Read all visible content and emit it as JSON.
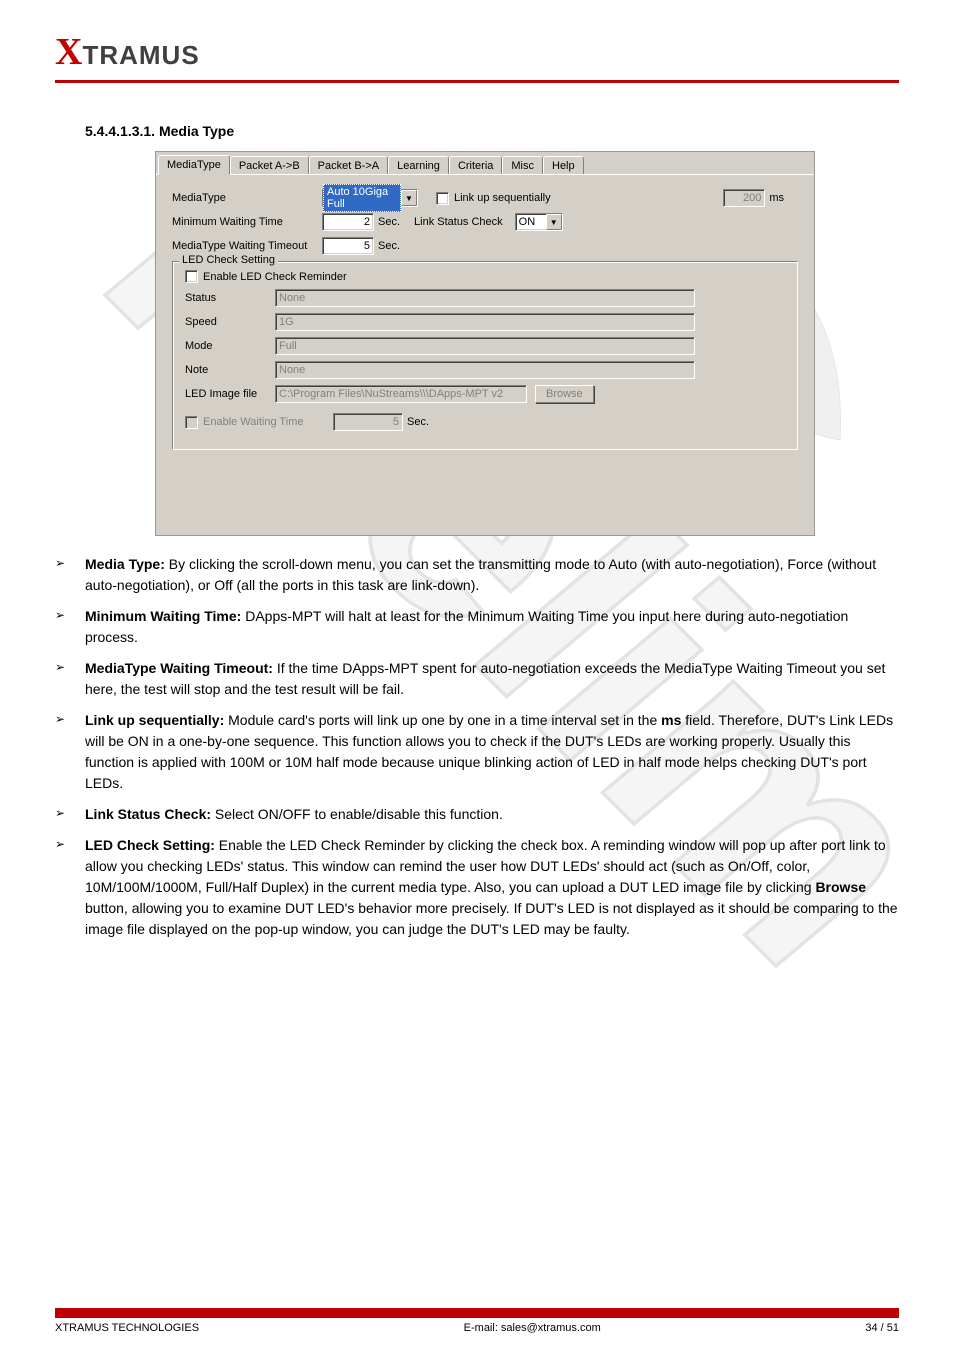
{
  "logo": {
    "x": "X",
    "rest": "TRAMUS"
  },
  "section_title": "5.4.4.1.3.1. Media Type",
  "panel": {
    "tabs": [
      "MediaType",
      "Packet A->B",
      "Packet B->A",
      "Learning",
      "Criteria",
      "Misc",
      "Help"
    ],
    "mediaType": {
      "label": "MediaType",
      "value": "Auto 10Giga Full"
    },
    "linkUpSeq": {
      "label": "Link up sequentially",
      "ms_value": "200",
      "ms_unit": "ms"
    },
    "minWait": {
      "label": "Minimum Waiting Time",
      "value": "2",
      "unit": "Sec."
    },
    "linkStatus": {
      "label": "Link Status Check",
      "value": "ON"
    },
    "mediaWait": {
      "label": "MediaType Waiting Timeout",
      "value": "5",
      "unit": "Sec."
    },
    "led": {
      "legend": "LED Check Setting",
      "enable": "Enable LED Check Reminder",
      "status": {
        "label": "Status",
        "value": "None"
      },
      "speed": {
        "label": "Speed",
        "value": "1G"
      },
      "mode": {
        "label": "Mode",
        "value": "Full"
      },
      "note": {
        "label": "Note",
        "value": "None"
      },
      "image": {
        "label": "LED Image file",
        "value": "C:\\Program Files\\NuStreams\\\\\\DApps-MPT v2",
        "browse": "Browse"
      },
      "enableWait": {
        "label": "Enable Waiting Time",
        "value": "5",
        "unit": "Sec."
      }
    }
  },
  "bullets": {
    "b1": {
      "title": "Media Type:",
      "text": " By clicking the scroll-down menu, you can set the transmitting mode to Auto (with auto-negotiation), Force (without auto-negotiation), or Off (all the ports in this task are link-down)."
    },
    "b2": {
      "title": "Minimum Waiting Time:",
      "text": " DApps-MPT will halt at least for the Minimum Waiting Time you input here during auto-negotiation process."
    },
    "b3": {
      "title": "MediaType Waiting Timeout:",
      "text": " If the time DApps-MPT spent for auto-negotiation exceeds the MediaType Waiting Timeout you set here, the test will stop and the test result will be fail."
    },
    "b4a": {
      "title": "Link up sequentially:",
      "text1": " Module card's ports will link up one by one in a time interval set in the ",
      "ms": "ms",
      "text2": " field. Therefore, DUT's Link LEDs will be ON in a one-by-one sequence. This function allows you to check if the DUT's LEDs are working properly. Usually this function is applied with 100M or 10M half mode because unique blinking action of LED in half mode helps checking DUT's port LEDs."
    },
    "b5": {
      "title": "Link Status Check:",
      "text": " Select ON/OFF to enable/disable this function."
    },
    "b6a": {
      "title": "LED Check Setting:",
      "text": " Enable the LED Check Reminder by clicking the check box. A reminding window will pop up after port link to allow you checking LEDs' status. This window can remind the user how DUT LEDs' should act (such as On/Off, color, 10M/100M/1000M, Full/Half Duplex) in the current media type. Also, you can upload a DUT LED image file by clicking ",
      "browse": "Browse",
      "text2": " button, allowing you to examine DUT LED's behavior more precisely. If DUT's LED is not displayed as it should be comparing to the image file displayed on the pop-up window, you can judge the DUT's LED may be faulty."
    }
  },
  "footer": {
    "left": "XTRAMUS TECHNOLOGIES",
    "center": "E-mail: sales@xtramus.com",
    "right": "34 / 51"
  }
}
